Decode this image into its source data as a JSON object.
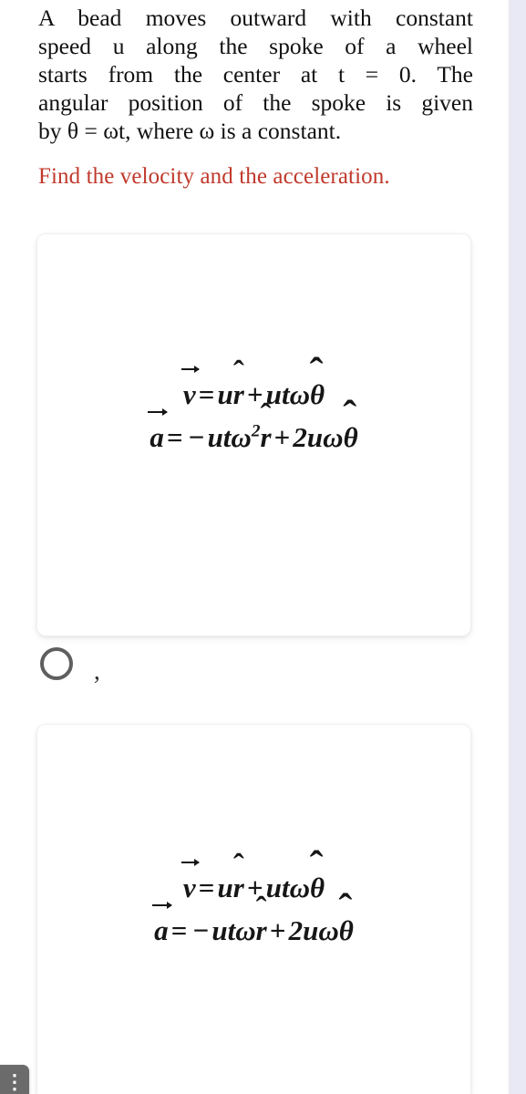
{
  "question": {
    "paragraph_lines": [
      "A bead moves outward with constant",
      "speed u along the spoke of a wheel",
      "starts from the center at t = 0. The",
      "angular position of the spoke is given",
      "by θ = ωt, where ω is a constant."
    ],
    "full_text": "A bead moves outward with constant speed u along the spoke of a wheel starts from the center at t = 0. The angular position of the spoke is given by θ = ωt, where ω is a constant.",
    "prompt": "Find the velocity and the acceleration.",
    "prompt_color": "#c0392b",
    "text_color": "#111111"
  },
  "answers": [
    {
      "id": "answer-option-1",
      "selected": false,
      "lines": [
        {
          "id": "velocity",
          "plain": "v⃗ = u r̂ + utω θ̂",
          "lhs_symbol": "v",
          "equals": "=",
          "term1_coeff": "u",
          "term1_unit": "r",
          "plus": "+",
          "term2_coeff": "utω",
          "term2_unit": "θ"
        },
        {
          "id": "acceleration",
          "plain": "a⃗ = −utω² r̂ + 2uω θ̂",
          "lhs_symbol": "a",
          "equals": "=",
          "minus": "−",
          "term1_coeff": "utω",
          "term1_exponent": "2",
          "term1_unit": "r",
          "plus": "+",
          "term2_coeff": "2uω",
          "term2_unit": "θ"
        }
      ]
    },
    {
      "id": "answer-option-2",
      "selected": false,
      "lines": [
        {
          "id": "velocity",
          "plain": "v⃗ = u r̂ + utω θ̂",
          "lhs_symbol": "v",
          "equals": "=",
          "term1_coeff": "u",
          "term1_unit": "r",
          "plus": "+",
          "term2_coeff": "utω",
          "term2_unit": "θ"
        },
        {
          "id": "acceleration",
          "plain": "a⃗ = −utω r̂ + 2uω θ̂",
          "lhs_symbol": "a",
          "equals": "=",
          "minus": "−",
          "term1_coeff": "utω",
          "term1_unit": "r",
          "plus": "+",
          "term2_coeff": "2uω",
          "term2_unit": "θ"
        }
      ]
    }
  ],
  "radio": {
    "trailing_mark": ",",
    "selected": false
  },
  "overflow_badge": {
    "glyph": "⋮",
    "background": "#6b6b6b"
  },
  "rail": {
    "color": "#e9e9f5"
  }
}
